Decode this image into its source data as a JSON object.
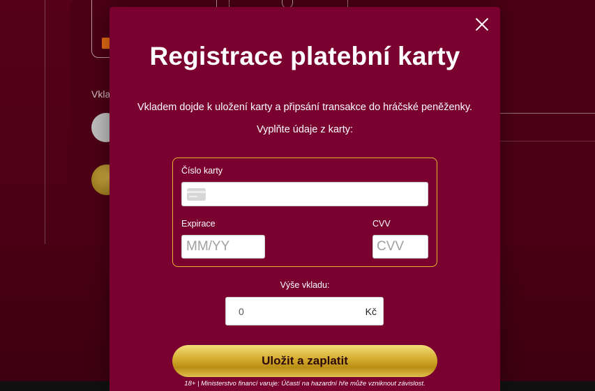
{
  "background": {
    "label": "Vkla"
  },
  "modal": {
    "title": "Registrace platební karty",
    "intro": "Vkladem dojde k uložení karty a připsání transakce do hráčské peněženky.",
    "instruction": "Vyplňte údaje z karty:",
    "card_number_label": "Číslo karty",
    "card_number_value": "",
    "expiry_label": "Expirace",
    "expiry_placeholder": "MM/YY",
    "cvv_label": "CVV",
    "cvv_placeholder": "CVV",
    "amount_label": "Výše vkladu:",
    "amount_value": "0",
    "currency": "Kč",
    "submit_label": "Uložit a zaplatit",
    "warning": "18+ | Ministerstvo financí varuje: Účastí na hazardní hře může vzniknout závislost."
  },
  "colors": {
    "modal_bg": "#7a0030",
    "accent_gold": "#e8b830",
    "page_bg": "#4c0016"
  },
  "icons": {
    "close": "close-icon",
    "card": "credit-card-icon"
  }
}
